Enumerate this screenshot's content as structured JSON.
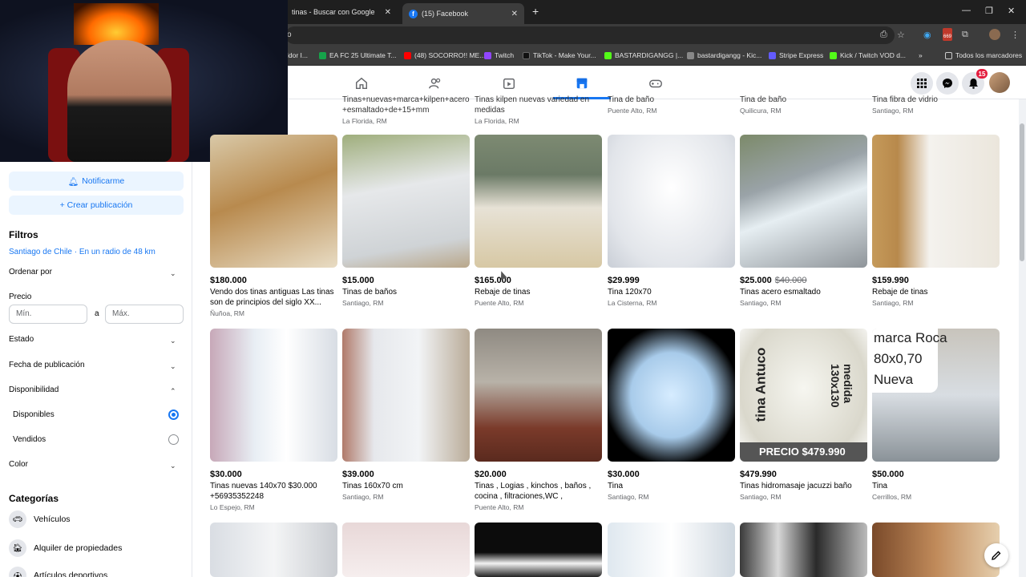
{
  "browser": {
    "tabs": [
      {
        "label": "tinas - Buscar con Google",
        "active": false
      },
      {
        "label": "(15) Facebook",
        "active": true
      }
    ],
    "address_fragment": "o",
    "bookmarks": [
      {
        "label": "idor I...",
        "color": "#4285f4"
      },
      {
        "label": "EA FC 25 Ultimate T...",
        "color": "#16a34a"
      },
      {
        "label": "(48) SOCORRO!! ME...",
        "color": "#ff0000"
      },
      {
        "label": "Twitch",
        "color": "#9146ff"
      },
      {
        "label": "TikTok - Make Your...",
        "color": "#111111"
      },
      {
        "label": "BASTARDIGANGG |...",
        "color": "#53fc18"
      },
      {
        "label": "bastardigangg - Kic...",
        "color": "#888888"
      },
      {
        "label": "Stripe Express",
        "color": "#635bff"
      },
      {
        "label": "Kick / Twitch VOD d...",
        "color": "#53fc18"
      },
      {
        "label": "Todos los marcadores",
        "color": "#cccccc"
      }
    ],
    "extension_badge": "669"
  },
  "fb_nav": {
    "notification_count": "15",
    "icons": [
      "home-icon",
      "friends-icon",
      "watch-icon",
      "marketplace-icon",
      "gaming-icon"
    ]
  },
  "sidebar": {
    "notify_label": "Notificarme",
    "create_label": "+ Crear publicación",
    "filters_heading": "Filtros",
    "location": "Santiago de Chile · En un radio de 48 km",
    "sort_label": "Ordenar por",
    "price_label": "Precio",
    "min_placeholder": "Mín.",
    "max_placeholder": "Máx.",
    "price_separator": "a",
    "condition_label": "Estado",
    "date_label": "Fecha de publicación",
    "availability_label": "Disponibilidad",
    "available_label": "Disponibles",
    "sold_label": "Vendidos",
    "color_label": "Color",
    "categories_heading": "Categorías",
    "categories": [
      {
        "label": "Vehículos",
        "icon": "car-icon"
      },
      {
        "label": "Alquiler de propiedades",
        "icon": "house-icon"
      },
      {
        "label": "Artículos deportivos",
        "icon": "sports-icon"
      }
    ]
  },
  "top_row": [
    {
      "title": "Tinas+nuevas+marca+kilpen+acero +esmaltado+de+15+mm",
      "loc": "La Florida, RM"
    },
    {
      "title": "Tinas kilpen nuevas variedad en medidas",
      "loc": "La Florida, RM"
    },
    {
      "title": "Tina de baño",
      "loc": "Puente Alto, RM"
    },
    {
      "title": "Tina de baño",
      "loc": "Quilicura, RM"
    },
    {
      "title": "Tina fibra de vidrio",
      "loc": "Santiago, RM"
    }
  ],
  "listings_row1": [
    {
      "price": "$180.000",
      "old_price": "",
      "title": "Vendo dos tinas antiguas Las tinas son de principios del siglo XX...",
      "loc": "Ñuñoa, RM"
    },
    {
      "price": "$15.000",
      "old_price": "",
      "title": "Tinas de baños",
      "loc": "Santiago, RM"
    },
    {
      "price": "$165.000",
      "old_price": "",
      "title": "Rebaje de tinas",
      "loc": "Puente Alto, RM"
    },
    {
      "price": "$29.999",
      "old_price": "",
      "title": "Tina 120x70",
      "loc": "La Cisterna, RM"
    },
    {
      "price": "$25.000",
      "old_price": "$40.000",
      "title": "Tinas acero esmaltado",
      "loc": "Santiago, RM"
    },
    {
      "price": "$159.990",
      "old_price": "",
      "title": "Rebaje de tinas",
      "loc": "Santiago, RM"
    }
  ],
  "listings_row2": [
    {
      "price": "$30.000",
      "old_price": "",
      "title": "Tinas nuevas 140x70 $30.000 +56935352248",
      "loc": "Lo Espejo, RM"
    },
    {
      "price": "$39.000",
      "old_price": "",
      "title": "Tinas 160x70 cm",
      "loc": "Santiago, RM"
    },
    {
      "price": "$20.000",
      "old_price": "",
      "title": "Tinas , Logias , kinchos , baños , cocina , filtraciones,WC , problema...",
      "loc": "Puente Alto, RM"
    },
    {
      "price": "$30.000",
      "old_price": "",
      "title": "Tina",
      "loc": "Santiago, RM"
    },
    {
      "price": "$479.990",
      "old_price": "",
      "title": "Tinas hidromasaje jacuzzi baño",
      "loc": "Santiago, RM"
    },
    {
      "price": "$50.000",
      "old_price": "",
      "title": "Tina",
      "loc": "Cerrillos, RM"
    }
  ],
  "image_overlays": {
    "antuco": "tina Antuco",
    "medida": "medida 130x130",
    "precio": "PRECIO $479.990",
    "roca_line1": "marca Roca",
    "roca_line2": "80x0,70",
    "roca_line3": "Nueva"
  }
}
